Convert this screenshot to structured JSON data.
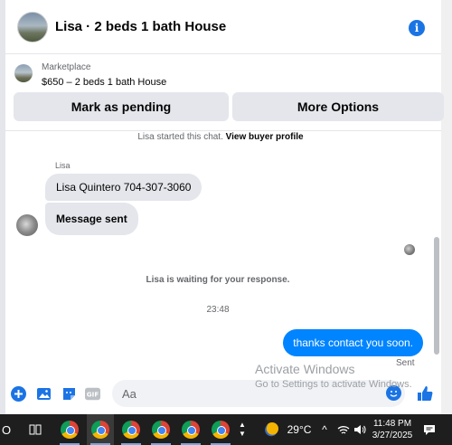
{
  "header": {
    "title": "Lisa · 2 beds 1 bath House",
    "info_icon": "i"
  },
  "listing": {
    "source": "Marketplace",
    "description": "$650 – 2 beds 1 bath House",
    "buttons": {
      "pending": "Mark as pending",
      "more": "More Options"
    }
  },
  "chat": {
    "notice_prefix": "Lisa started this chat.",
    "notice_link": "View buyer profile",
    "sender_name": "Lisa",
    "incoming": [
      "Lisa Quintero 704-307-3060",
      "Message sent"
    ],
    "waiting": "Lisa is waiting for your response.",
    "timestamp": "23:48",
    "outgoing": "thanks contact you soon.",
    "status": "Sent"
  },
  "composer": {
    "placeholder": "Aa"
  },
  "watermark": {
    "line1": "Activate Windows",
    "line2": "Go to Settings to activate Windows."
  },
  "taskbar": {
    "search_icon": "O",
    "weather": "29°C",
    "tray_arrow": "^",
    "time": "11:48 PM",
    "date": "3/27/2025"
  },
  "colors": {
    "accent": "#0084ff",
    "brand": "#1b74e4",
    "bubble_in": "#e4e6eb"
  }
}
